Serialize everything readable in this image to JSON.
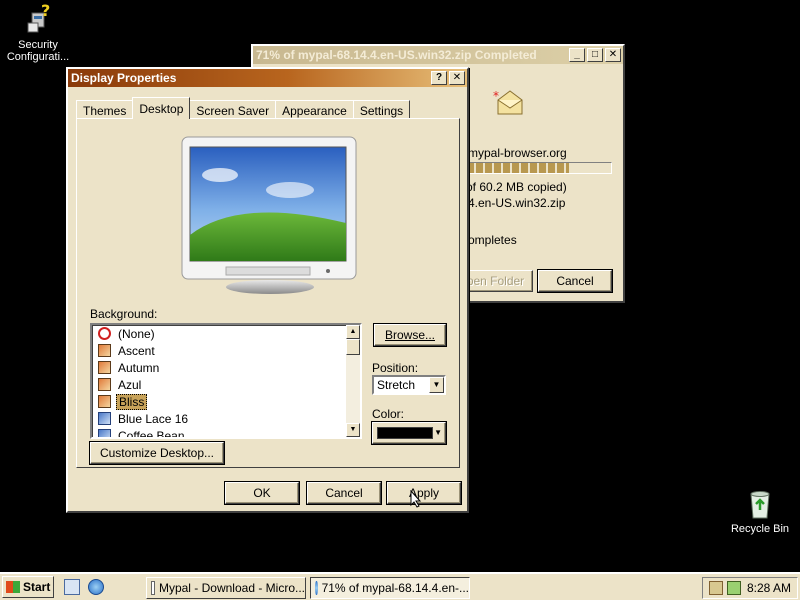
{
  "desktop": {
    "icons": [
      {
        "name": "security-configuration-icon",
        "label": "Security\nConfigurati..."
      },
      {
        "name": "recycle-bin-icon",
        "label": "Recycle Bin"
      }
    ]
  },
  "download_window": {
    "title": "71% of mypal-68.14.4.en-US.win32.zip Completed",
    "source": "mypal-browser.org",
    "progress_fraction": 0.71,
    "copied_text": "of 60.2 MB copied)",
    "filename_text": "4.en-US.win32.zip",
    "completes_text": "ompletes",
    "open_folder_label": "pen Folder",
    "cancel_label": "Cancel"
  },
  "display_properties": {
    "title": "Display Properties",
    "help_label": "?",
    "close_label": "✕",
    "tabs": [
      "Themes",
      "Desktop",
      "Screen Saver",
      "Appearance",
      "Settings"
    ],
    "selected_tab": "Desktop",
    "background_label": "Background:",
    "backgrounds": [
      "(None)",
      "Ascent",
      "Autumn",
      "Azul",
      "Bliss",
      "Blue Lace 16",
      "Coffee Bean"
    ],
    "selected_background": "Bliss",
    "browse_label": "Browse...",
    "position_label": "Position:",
    "position_value": "Stretch",
    "color_label": "Color:",
    "color_value": "#000000",
    "customize_label": "Customize Desktop...",
    "ok_label": "OK",
    "cancel_label": "Cancel",
    "apply_label": "Apply"
  },
  "taskbar": {
    "start_label": "Start",
    "tasks": [
      {
        "label": "Mypal - Download - Micro..."
      },
      {
        "label": "71% of mypal-68.14.4.en-..."
      }
    ],
    "clock": "8:28 AM"
  }
}
